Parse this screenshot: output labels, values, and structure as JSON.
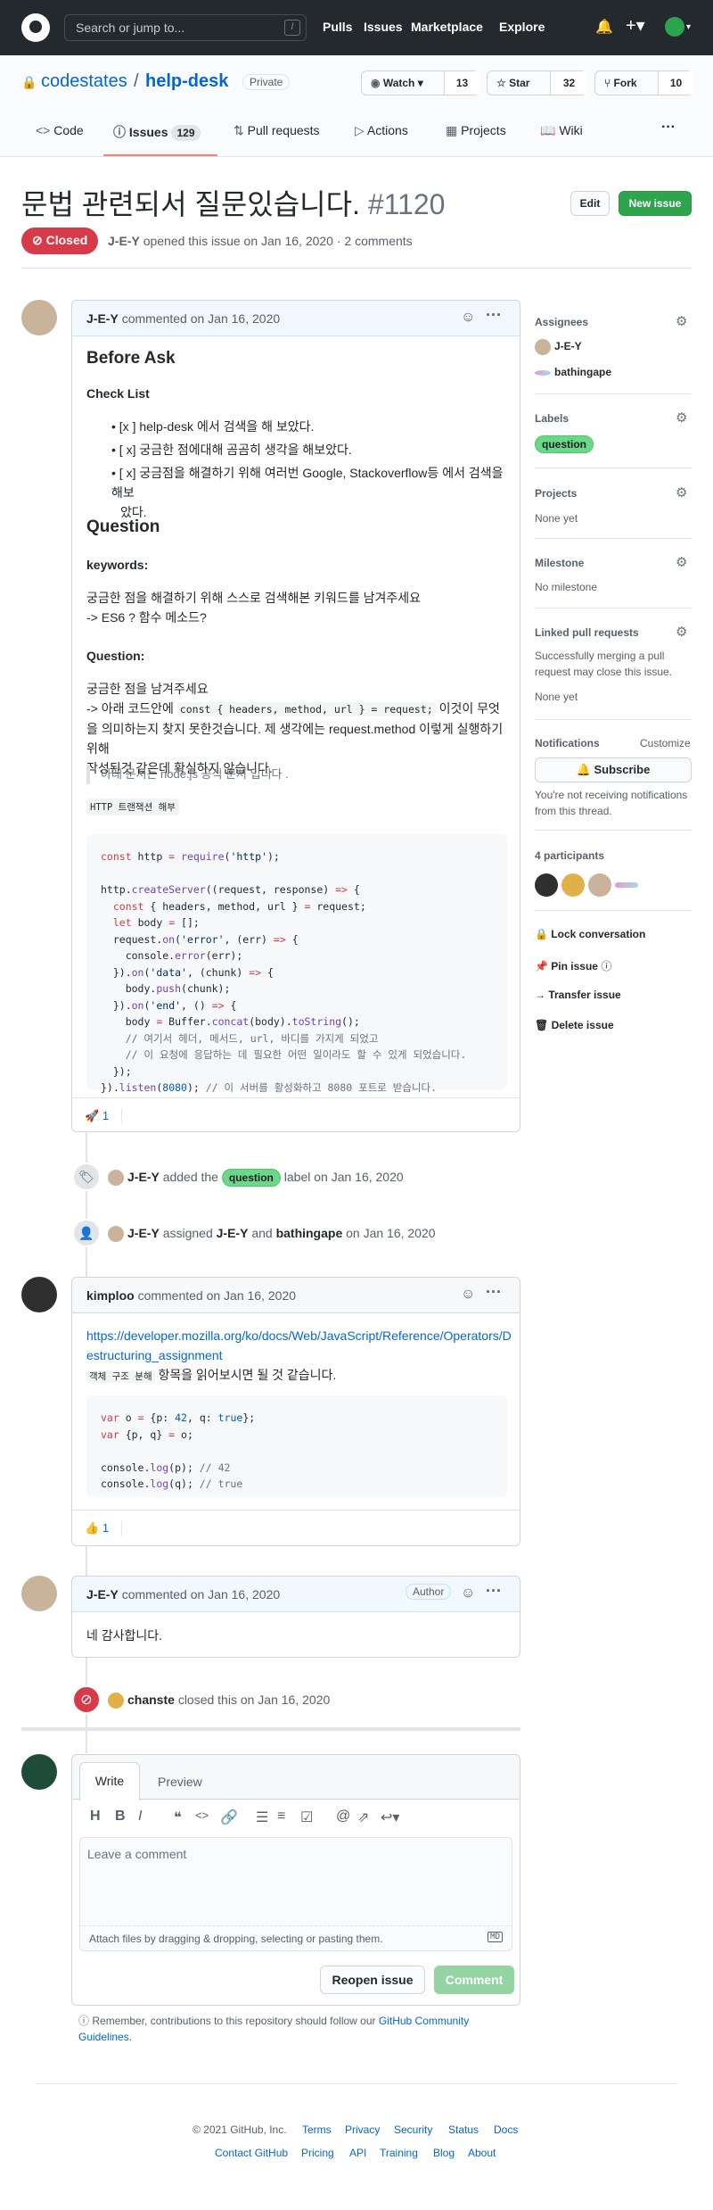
{
  "header": {
    "search_placeholder": "Search or jump to...",
    "slash": "/",
    "nav": [
      "Pulls",
      "Issues",
      "Marketplace",
      "Explore"
    ]
  },
  "repo": {
    "owner": "codestates",
    "sep": "/",
    "name": "help-desk",
    "visibility": "Private",
    "watch": "Watch",
    "watch_count": "13",
    "star": "Star",
    "star_count": "32",
    "fork": "Fork",
    "fork_count": "10"
  },
  "tabs": {
    "code": "Code",
    "issues": "Issues",
    "issues_count": "129",
    "pulls": "Pull requests",
    "actions": "Actions",
    "projects": "Projects",
    "wiki": "Wiki",
    "more": "···"
  },
  "issue": {
    "title": "문법 관련되서 질문있습니다.",
    "number": "#1120",
    "edit": "Edit",
    "new_issue": "New issue",
    "state": "Closed",
    "author": "J-E-Y",
    "meta": "opened this issue on Jan 16, 2020 · 2 comments"
  },
  "comment1": {
    "author": "J-E-Y",
    "meta": "commented on Jan 16, 2020",
    "h_before": "Before Ask",
    "h_check": "Check List",
    "checks": [
      "[x ] help-desk 에서 검색을 해 보았다.",
      "[ x] 궁금한 점에대해 곰곰히 생각을 해보았다.",
      "[ x] 궁금점을 해결하기 위해 여러번 Google, Stackoverflow등 에서 검색을 해보",
      "았다."
    ],
    "h_question": "Question",
    "h_keywords": "keywords:",
    "kw1": "궁금한 점을 해결하기 위해 스스로 검색해본 키워드를 남겨주세요",
    "kw2": "-> ES6 ? 함수 메소드?",
    "h_q2": "Question:",
    "q1": "궁금한 점을 남겨주세요",
    "q2a": "-> 아래 코드안에",
    "q2code": "const { headers, method, url } = request;",
    "q2b": "이것이 무엇",
    "q3": "을 의미하는지 찾지 못한것습니다. 제 생각에는 request.method 이렇게 실행하기 위해",
    "q4": "작성된것 같은데 확실하지 않습니다.",
    "quote": "아래 문서는 node.js 공식 문서 입니다 .",
    "tag": "HTTP 트랜잭션 해부",
    "reaction": "🚀",
    "reaction_count": "1"
  },
  "events": {
    "label_user": "J-E-Y",
    "label_text1": "added the",
    "label_name": "question",
    "label_text2": "label on Jan 16, 2020",
    "assign_user": "J-E-Y",
    "assign_text1": "assigned",
    "assign_a": "J-E-Y",
    "assign_and": "and",
    "assign_b": "bathingape",
    "assign_text2": "on Jan 16, 2020",
    "close_user": "chanste",
    "close_text": "closed this on Jan 16, 2020"
  },
  "comment2": {
    "author": "kimploo",
    "meta": "commented on Jan 16, 2020",
    "link1": "https://developer.mozilla.org/ko/docs/Web/JavaScript/Reference/Operators/D",
    "link2": "estructuring_assignment",
    "code_inline": "객체 구조 분해",
    "text": "항목을 읽어보시면 될 것 같습니다.",
    "reaction": "👍",
    "reaction_count": "1"
  },
  "comment3": {
    "author": "J-E-Y",
    "meta": "commented on Jan 16, 2020",
    "author_badge": "Author",
    "body": "네 감사합니다."
  },
  "sidebar": {
    "assignees": "Assignees",
    "assignee1": "J-E-Y",
    "assignee2": "bathingape",
    "labels": "Labels",
    "label": "question",
    "projects": "Projects",
    "projects_val": "None yet",
    "milestone": "Milestone",
    "milestone_val": "No milestone",
    "linked": "Linked pull requests",
    "linked_desc1": "Successfully merging a pull",
    "linked_desc2": "request may close this issue.",
    "linked_val": "None yet",
    "notifications": "Notifications",
    "customize": "Customize",
    "subscribe": "Subscribe",
    "notif_desc1": "You're not receiving notifications",
    "notif_desc2": "from this thread.",
    "participants": "4 participants",
    "lock": "Lock conversation",
    "pin": "Pin issue",
    "transfer": "Transfer issue",
    "delete": "Delete issue"
  },
  "editor": {
    "write": "Write",
    "preview": "Preview",
    "placeholder": "Leave a comment",
    "attach": "Attach files by dragging & dropping, selecting or pasting them.",
    "md": "MD",
    "reopen": "Reopen issue",
    "comment": "Comment",
    "guide_text": "Remember, contributions to this repository should follow our",
    "guide_link1": "GitHub Community",
    "guide_link2": "Guidelines."
  },
  "footer": {
    "copy": "© 2021 GitHub, Inc.",
    "row1": [
      "Terms",
      "Privacy",
      "Security",
      "Status",
      "Docs"
    ],
    "row2": [
      "Contact GitHub",
      "Pricing",
      "API",
      "Training",
      "Blog",
      "About"
    ]
  }
}
